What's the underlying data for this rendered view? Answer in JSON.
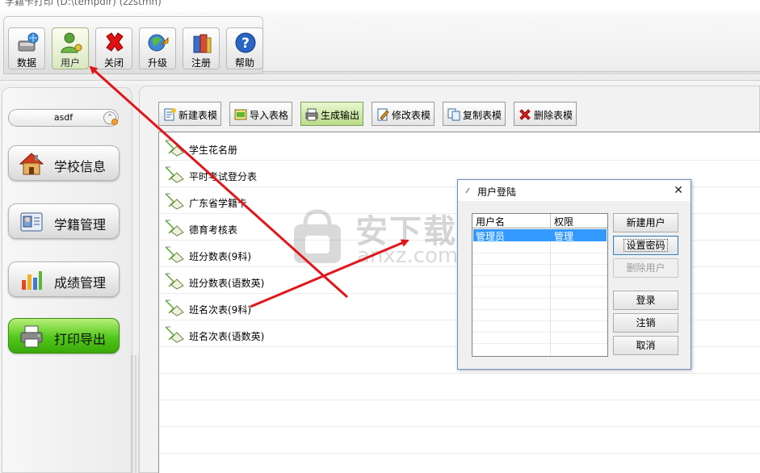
{
  "window": {
    "title": "学籍卡打印 (D:\\tempdir) (zzstmn)"
  },
  "toolbar": {
    "buttons": [
      {
        "id": "data",
        "label": "数据",
        "icon": "database-icon"
      },
      {
        "id": "user",
        "label": "用户",
        "icon": "user-icon"
      },
      {
        "id": "close",
        "label": "关闭",
        "icon": "close-icon"
      },
      {
        "id": "upgrade",
        "label": "升级",
        "icon": "upgrade-icon"
      },
      {
        "id": "register",
        "label": "注册",
        "icon": "register-icon"
      },
      {
        "id": "help",
        "label": "帮助",
        "icon": "help-icon"
      }
    ],
    "active": "user"
  },
  "sidebar": {
    "user_select": "asdf",
    "items": [
      {
        "label": "学校信息",
        "icon": "school-icon"
      },
      {
        "label": "学籍管理",
        "icon": "student-card-icon"
      },
      {
        "label": "成绩管理",
        "icon": "bar-chart-icon"
      },
      {
        "label": "打印导出",
        "icon": "printer-icon"
      }
    ],
    "active_index": 3
  },
  "actions": {
    "buttons": [
      {
        "label": "新建表模",
        "icon": "new-doc-icon"
      },
      {
        "label": "导入表格",
        "icon": "import-icon"
      },
      {
        "label": "生成输出",
        "icon": "output-icon"
      },
      {
        "label": "修改表模",
        "icon": "edit-icon"
      },
      {
        "label": "复制表模",
        "icon": "copy-icon"
      },
      {
        "label": "删除表模",
        "icon": "delete-icon"
      }
    ],
    "active_index": 2
  },
  "templates": {
    "items": [
      "学生花名册",
      "平时考试登分表",
      "广东省学籍卡",
      "德育考核表",
      "班分数表(9科)",
      "班分数表(语数英)",
      "班名次表(9科)",
      "班名次表(语数英)"
    ]
  },
  "dialog": {
    "title": "用户登陆",
    "columns": [
      "用户名",
      "权限"
    ],
    "rows": [
      {
        "name": "管理员",
        "role": "管理"
      }
    ],
    "buttons": {
      "new_user": "新建用户",
      "set_password": "设置密码",
      "delete_user": "删除用户",
      "login": "登录",
      "logout": "注销",
      "cancel": "取消"
    }
  },
  "watermark": {
    "text": "安下载",
    "sub": "anxz.com"
  },
  "colors": {
    "accent_green": "#52c81a",
    "selection_blue": "#3399ff",
    "annotation_red": "#e0161b"
  }
}
